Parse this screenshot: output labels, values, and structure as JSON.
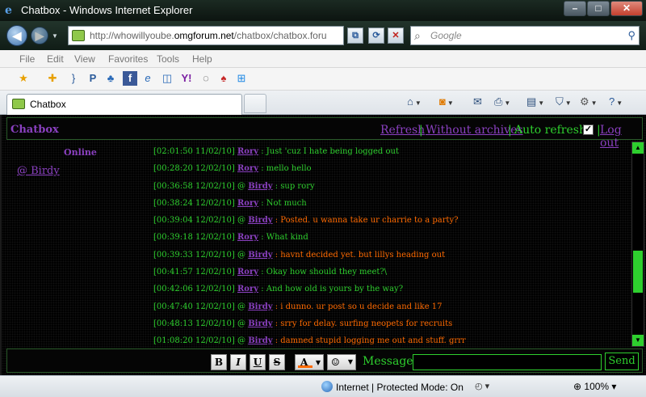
{
  "window": {
    "title": "Chatbox - Windows Internet Explorer",
    "min_label": "–",
    "max_label": "□",
    "close_label": "✕"
  },
  "address": {
    "url_prefix": "http://whowillyoube.",
    "url_domain": "omgforum.net",
    "url_suffix": "/chatbox/chatbox.foru"
  },
  "search": {
    "placeholder": "Google"
  },
  "menu": [
    "File",
    "Edit",
    "View",
    "Favorites",
    "Tools",
    "Help"
  ],
  "tab": {
    "label": "Chatbox"
  },
  "chat": {
    "title": "Chatbox",
    "links": {
      "refresh": "Refresh",
      "without_archives": "Without archives",
      "auto_refresh": "Auto refresh",
      "logout": "Log out"
    },
    "separator": "|",
    "auto_refresh_checked": "✓",
    "online_label": "Online",
    "online_users": [
      "@ Birdy"
    ],
    "messages": [
      {
        "ts": "[02:01:50 11/02/10]",
        "at": "",
        "user": "Rory",
        "text": " : Just 'cuz I hate being logged out",
        "kind": "rory"
      },
      {
        "ts": "[00:28:20 12/02/10]",
        "at": "",
        "user": "Rory",
        "text": " : mello hello",
        "kind": "rory"
      },
      {
        "ts": "[00:36:58 12/02/10]",
        "at": "@",
        "user": "Birdy",
        "text": " : sup rory",
        "kind": "rory"
      },
      {
        "ts": "[00:38:24 12/02/10]",
        "at": "",
        "user": "Rory",
        "text": " : Not much",
        "kind": "rory"
      },
      {
        "ts": "[00:39:04 12/02/10]",
        "at": "@",
        "user": "Birdy",
        "text": " : Posted. u wanna take ur charrie to a party?",
        "kind": "birdy"
      },
      {
        "ts": "[00:39:18 12/02/10]",
        "at": "",
        "user": "Rory",
        "text": " : What kind",
        "kind": "rory"
      },
      {
        "ts": "[00:39:33 12/02/10]",
        "at": "@",
        "user": "Birdy",
        "text": " : havnt decided yet. but lillys heading out",
        "kind": "birdy"
      },
      {
        "ts": "[00:41:57 12/02/10]",
        "at": "",
        "user": "Rory",
        "text": " : Okay how should they meet?\\",
        "kind": "rory"
      },
      {
        "ts": "[00:42:06 12/02/10]",
        "at": "",
        "user": "Rory",
        "text": " : And how old is yours by the way?",
        "kind": "rory"
      },
      {
        "ts": "[00:47:40 12/02/10]",
        "at": "@",
        "user": "Birdy",
        "text": " : i dunno. ur post so u decide and like 17",
        "kind": "birdy"
      },
      {
        "ts": "[00:48:13 12/02/10]",
        "at": "@",
        "user": "Birdy",
        "text": " : srry for delay. surfing neopets for recruits",
        "kind": "birdy"
      },
      {
        "ts": "[01:08:20 12/02/10]",
        "at": "@",
        "user": "Birdy",
        "text": " : damned stupid logging me out and stuff. grrr",
        "kind": "birdy"
      }
    ],
    "toolbar": {
      "bold": "B",
      "italic": "I",
      "underline": "U",
      "strike": "S",
      "color": "A",
      "smiley": "☺"
    },
    "message_label": "Message :",
    "message_value": "",
    "send_label": "Send"
  },
  "status": {
    "zone": "Internet | Protected Mode: On",
    "zoom": "100%"
  },
  "colors": {
    "chat_green": "#2ecf2e",
    "chat_purple": "#8a40c0",
    "chat_orange": "#ff6a00"
  }
}
